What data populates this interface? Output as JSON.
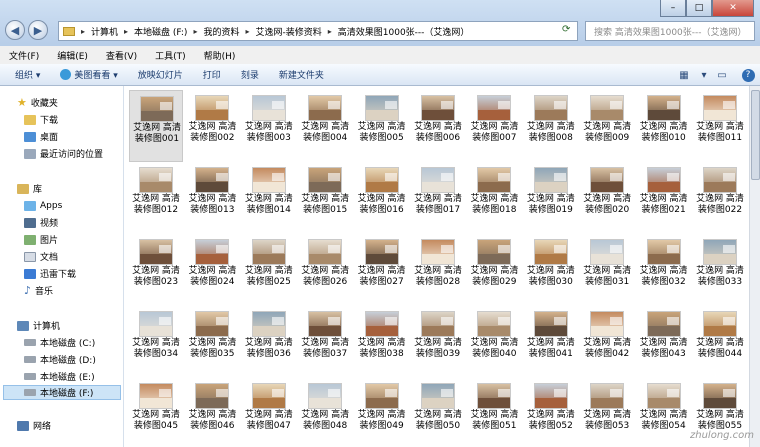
{
  "address": {
    "crumbs": [
      "计算机",
      "本地磁盘 (F:)",
      "我的资料",
      "艾逸网-装修资料",
      "高清效果图1000张---（艾逸网）"
    ]
  },
  "search": {
    "placeholder": "搜索 高清效果图1000张---（艾逸网）"
  },
  "menu": {
    "items": [
      "文件(F)",
      "编辑(E)",
      "查看(V)",
      "工具(T)",
      "帮助(H)"
    ]
  },
  "toolbar": {
    "organize": "组织 ▾",
    "viewer": "美图看看 ▾",
    "slideshow": "放映幻灯片",
    "print": "打印",
    "burn": "刻录",
    "new_folder": "新建文件夹"
  },
  "sidebar": {
    "favorites": "收藏夹",
    "downloads": "下载",
    "desktop": "桌面",
    "recent": "最近访问的位置",
    "library": "库",
    "apps": "Apps",
    "video": "视频",
    "pictures": "图片",
    "documents": "文档",
    "xunlei": "迅雷下载",
    "music": "音乐",
    "computer": "计算机",
    "disk_c": "本地磁盘 (C:)",
    "disk_d": "本地磁盘 (D:)",
    "disk_e": "本地磁盘 (E:)",
    "disk_f": "本地磁盘 (F:)",
    "network": "网络"
  },
  "files": {
    "prefix": "艾逸网 高清装修图",
    "numbers": [
      "001",
      "002",
      "003",
      "004",
      "005",
      "006",
      "007",
      "008",
      "009",
      "010",
      "011",
      "012",
      "013",
      "014",
      "015",
      "016",
      "017",
      "018",
      "019",
      "020",
      "021",
      "022",
      "023",
      "024",
      "025",
      "026",
      "027",
      "028",
      "029",
      "030",
      "031",
      "032",
      "033",
      "034",
      "035",
      "036",
      "037",
      "038",
      "039",
      "040",
      "041",
      "042",
      "043",
      "044",
      "045",
      "046",
      "047",
      "048",
      "049",
      "050",
      "051",
      "052",
      "053",
      "054",
      "055"
    ]
  },
  "watermark": "zhulong.com",
  "colors": {
    "accent": "#2c5f9e",
    "selection": "#cde4f7"
  }
}
